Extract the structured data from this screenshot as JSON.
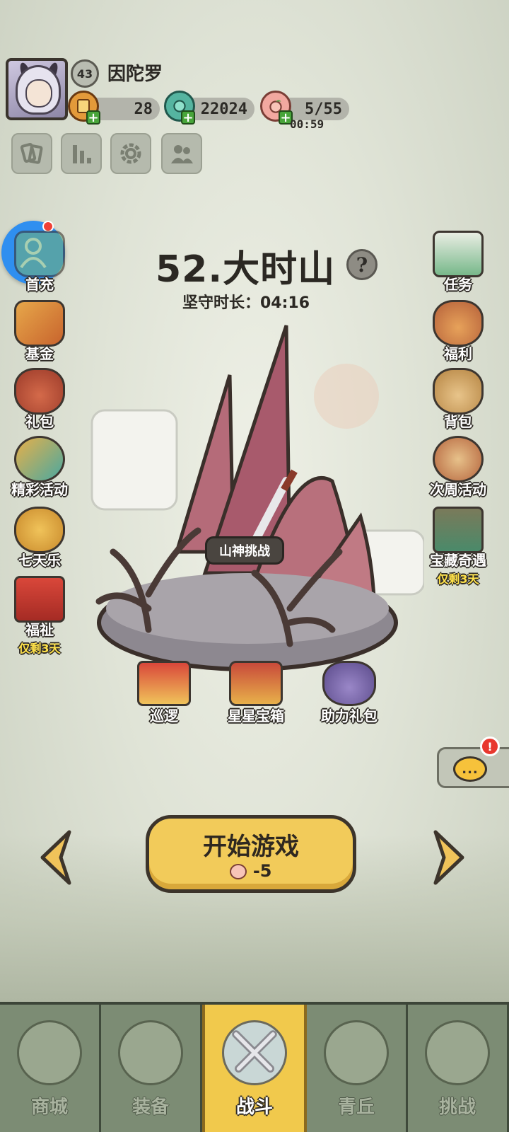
{
  "player": {
    "name": "因陀罗",
    "level": "43"
  },
  "resources": {
    "ticket": {
      "value": "28"
    },
    "jade": {
      "value": "22024"
    },
    "stamina": {
      "value": "5/55",
      "timer": "00:59"
    }
  },
  "stage": {
    "title": "52.大时山",
    "help": "?",
    "hold_time": "坚守时长：04:16",
    "challenge": "山神挑战"
  },
  "left_menu": [
    {
      "label": "首充"
    },
    {
      "label": "基金"
    },
    {
      "label": "礼包"
    },
    {
      "label": "精彩活动"
    },
    {
      "label": "七天乐"
    },
    {
      "label": "福祉",
      "sub": "仅剩3天"
    }
  ],
  "right_menu": [
    {
      "label": "任务"
    },
    {
      "label": "福利"
    },
    {
      "label": "背包"
    },
    {
      "label": "次周活动"
    },
    {
      "label": "宝藏奇遇",
      "sub": "仅剩3天"
    }
  ],
  "base_items": [
    {
      "label": "巡逻"
    },
    {
      "label": "星星宝箱"
    },
    {
      "label": "助力礼包"
    }
  ],
  "chat": {
    "badge": "!",
    "bubble": "..."
  },
  "start": {
    "label": "开始游戏",
    "cost": "-5"
  },
  "nav": [
    {
      "label": "商城"
    },
    {
      "label": "装备"
    },
    {
      "label": "战斗",
      "active": true
    },
    {
      "label": "青丘"
    },
    {
      "label": "挑战"
    }
  ]
}
